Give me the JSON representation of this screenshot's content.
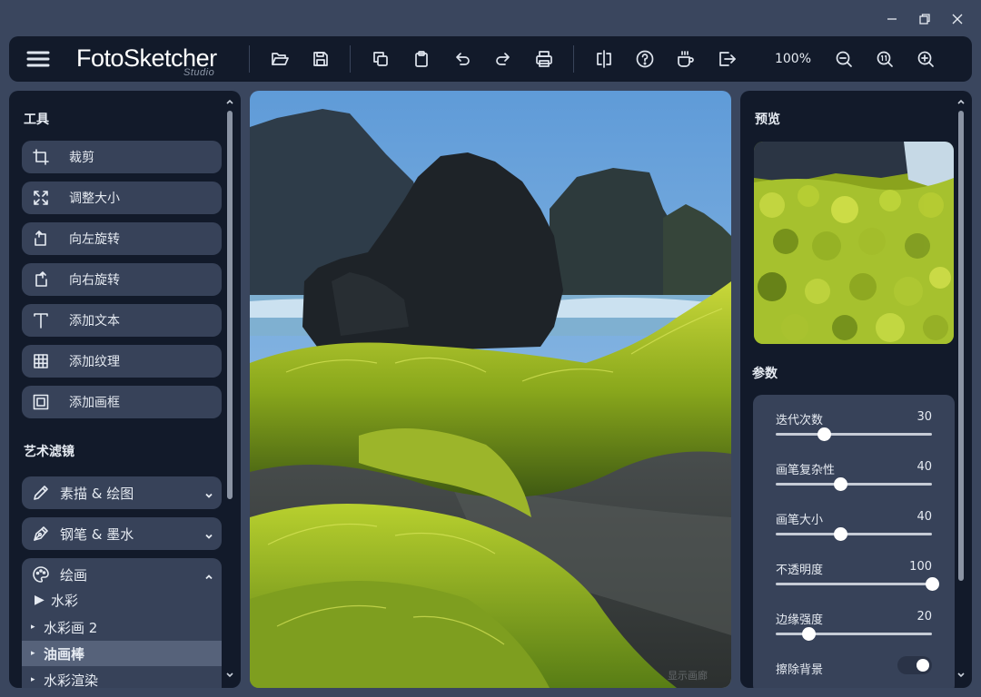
{
  "window": {
    "controls": [
      "minimize",
      "restore",
      "close"
    ]
  },
  "toolbar": {
    "logo_main": "FotoSketcher",
    "logo_sub": "Studio",
    "zoom": "100%",
    "icons": [
      "menu-icon",
      "open-folder-icon",
      "save-icon",
      "copy-icon",
      "paste-icon",
      "undo-icon",
      "redo-icon",
      "print-icon",
      "compare-icon",
      "help-icon",
      "coffee-icon",
      "exit-icon",
      "zoom-out-icon",
      "zoom-fit-icon",
      "zoom-in-icon"
    ]
  },
  "left_panel": {
    "tools_title": "工具",
    "tools": [
      {
        "label": "裁剪",
        "icon": "crop-icon"
      },
      {
        "label": "调整大小",
        "icon": "resize-icon"
      },
      {
        "label": "向左旋转",
        "icon": "rotate-left-icon"
      },
      {
        "label": "向右旋转",
        "icon": "rotate-right-icon"
      },
      {
        "label": "添加文本",
        "icon": "text-icon"
      },
      {
        "label": "添加纹理",
        "icon": "texture-icon"
      },
      {
        "label": "添加画框",
        "icon": "frame-icon"
      }
    ],
    "filters_title": "艺术滤镜",
    "filters": [
      {
        "label": "素描 & 绘图",
        "icon": "pencil-icon",
        "expanded": false
      },
      {
        "label": "钢笔 & 墨水",
        "icon": "pen-nib-icon",
        "expanded": false
      }
    ],
    "painting": {
      "label": "绘画",
      "icon": "palette-icon",
      "expanded": true,
      "items": [
        {
          "label": "水彩",
          "marker": "▶",
          "selected": false
        },
        {
          "label": "水彩画 2",
          "marker": "▸",
          "selected": false
        },
        {
          "label": "油画棒",
          "marker": "▸",
          "selected": true
        },
        {
          "label": "水彩渲染",
          "marker": "▸",
          "selected": false
        }
      ]
    }
  },
  "canvas": {
    "watermark": "显示画廊"
  },
  "right_panel": {
    "preview_title": "预览",
    "params_title": "参数",
    "params": [
      {
        "label": "迭代次数",
        "value": "30",
        "fraction": 0.31
      },
      {
        "label": "画笔复杂性",
        "value": "40",
        "fraction": 0.41
      },
      {
        "label": "画笔大小",
        "value": "40",
        "fraction": 0.41
      },
      {
        "label": "不透明度",
        "value": "100",
        "fraction": 1.0
      },
      {
        "label": "边缘强度",
        "value": "20",
        "fraction": 0.21
      }
    ],
    "toggle": {
      "label": "擦除背景",
      "on": true
    }
  }
}
